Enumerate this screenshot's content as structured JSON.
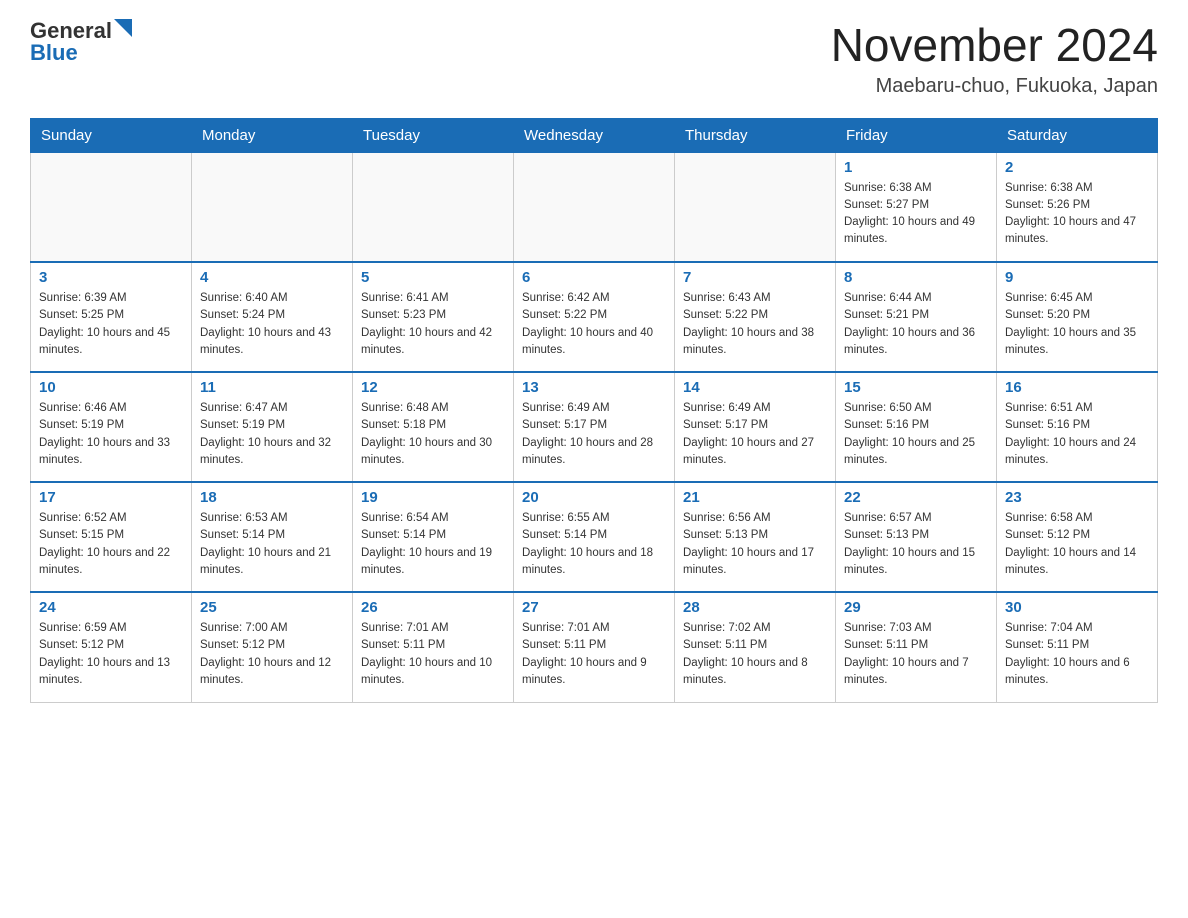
{
  "header": {
    "logo_general": "General",
    "logo_blue": "Blue",
    "month_title": "November 2024",
    "location": "Maebaru-chuo, Fukuoka, Japan"
  },
  "weekdays": [
    "Sunday",
    "Monday",
    "Tuesday",
    "Wednesday",
    "Thursday",
    "Friday",
    "Saturday"
  ],
  "weeks": [
    [
      {
        "day": "",
        "info": ""
      },
      {
        "day": "",
        "info": ""
      },
      {
        "day": "",
        "info": ""
      },
      {
        "day": "",
        "info": ""
      },
      {
        "day": "",
        "info": ""
      },
      {
        "day": "1",
        "info": "Sunrise: 6:38 AM\nSunset: 5:27 PM\nDaylight: 10 hours and 49 minutes."
      },
      {
        "day": "2",
        "info": "Sunrise: 6:38 AM\nSunset: 5:26 PM\nDaylight: 10 hours and 47 minutes."
      }
    ],
    [
      {
        "day": "3",
        "info": "Sunrise: 6:39 AM\nSunset: 5:25 PM\nDaylight: 10 hours and 45 minutes."
      },
      {
        "day": "4",
        "info": "Sunrise: 6:40 AM\nSunset: 5:24 PM\nDaylight: 10 hours and 43 minutes."
      },
      {
        "day": "5",
        "info": "Sunrise: 6:41 AM\nSunset: 5:23 PM\nDaylight: 10 hours and 42 minutes."
      },
      {
        "day": "6",
        "info": "Sunrise: 6:42 AM\nSunset: 5:22 PM\nDaylight: 10 hours and 40 minutes."
      },
      {
        "day": "7",
        "info": "Sunrise: 6:43 AM\nSunset: 5:22 PM\nDaylight: 10 hours and 38 minutes."
      },
      {
        "day": "8",
        "info": "Sunrise: 6:44 AM\nSunset: 5:21 PM\nDaylight: 10 hours and 36 minutes."
      },
      {
        "day": "9",
        "info": "Sunrise: 6:45 AM\nSunset: 5:20 PM\nDaylight: 10 hours and 35 minutes."
      }
    ],
    [
      {
        "day": "10",
        "info": "Sunrise: 6:46 AM\nSunset: 5:19 PM\nDaylight: 10 hours and 33 minutes."
      },
      {
        "day": "11",
        "info": "Sunrise: 6:47 AM\nSunset: 5:19 PM\nDaylight: 10 hours and 32 minutes."
      },
      {
        "day": "12",
        "info": "Sunrise: 6:48 AM\nSunset: 5:18 PM\nDaylight: 10 hours and 30 minutes."
      },
      {
        "day": "13",
        "info": "Sunrise: 6:49 AM\nSunset: 5:17 PM\nDaylight: 10 hours and 28 minutes."
      },
      {
        "day": "14",
        "info": "Sunrise: 6:49 AM\nSunset: 5:17 PM\nDaylight: 10 hours and 27 minutes."
      },
      {
        "day": "15",
        "info": "Sunrise: 6:50 AM\nSunset: 5:16 PM\nDaylight: 10 hours and 25 minutes."
      },
      {
        "day": "16",
        "info": "Sunrise: 6:51 AM\nSunset: 5:16 PM\nDaylight: 10 hours and 24 minutes."
      }
    ],
    [
      {
        "day": "17",
        "info": "Sunrise: 6:52 AM\nSunset: 5:15 PM\nDaylight: 10 hours and 22 minutes."
      },
      {
        "day": "18",
        "info": "Sunrise: 6:53 AM\nSunset: 5:14 PM\nDaylight: 10 hours and 21 minutes."
      },
      {
        "day": "19",
        "info": "Sunrise: 6:54 AM\nSunset: 5:14 PM\nDaylight: 10 hours and 19 minutes."
      },
      {
        "day": "20",
        "info": "Sunrise: 6:55 AM\nSunset: 5:14 PM\nDaylight: 10 hours and 18 minutes."
      },
      {
        "day": "21",
        "info": "Sunrise: 6:56 AM\nSunset: 5:13 PM\nDaylight: 10 hours and 17 minutes."
      },
      {
        "day": "22",
        "info": "Sunrise: 6:57 AM\nSunset: 5:13 PM\nDaylight: 10 hours and 15 minutes."
      },
      {
        "day": "23",
        "info": "Sunrise: 6:58 AM\nSunset: 5:12 PM\nDaylight: 10 hours and 14 minutes."
      }
    ],
    [
      {
        "day": "24",
        "info": "Sunrise: 6:59 AM\nSunset: 5:12 PM\nDaylight: 10 hours and 13 minutes."
      },
      {
        "day": "25",
        "info": "Sunrise: 7:00 AM\nSunset: 5:12 PM\nDaylight: 10 hours and 12 minutes."
      },
      {
        "day": "26",
        "info": "Sunrise: 7:01 AM\nSunset: 5:11 PM\nDaylight: 10 hours and 10 minutes."
      },
      {
        "day": "27",
        "info": "Sunrise: 7:01 AM\nSunset: 5:11 PM\nDaylight: 10 hours and 9 minutes."
      },
      {
        "day": "28",
        "info": "Sunrise: 7:02 AM\nSunset: 5:11 PM\nDaylight: 10 hours and 8 minutes."
      },
      {
        "day": "29",
        "info": "Sunrise: 7:03 AM\nSunset: 5:11 PM\nDaylight: 10 hours and 7 minutes."
      },
      {
        "day": "30",
        "info": "Sunrise: 7:04 AM\nSunset: 5:11 PM\nDaylight: 10 hours and 6 minutes."
      }
    ]
  ]
}
